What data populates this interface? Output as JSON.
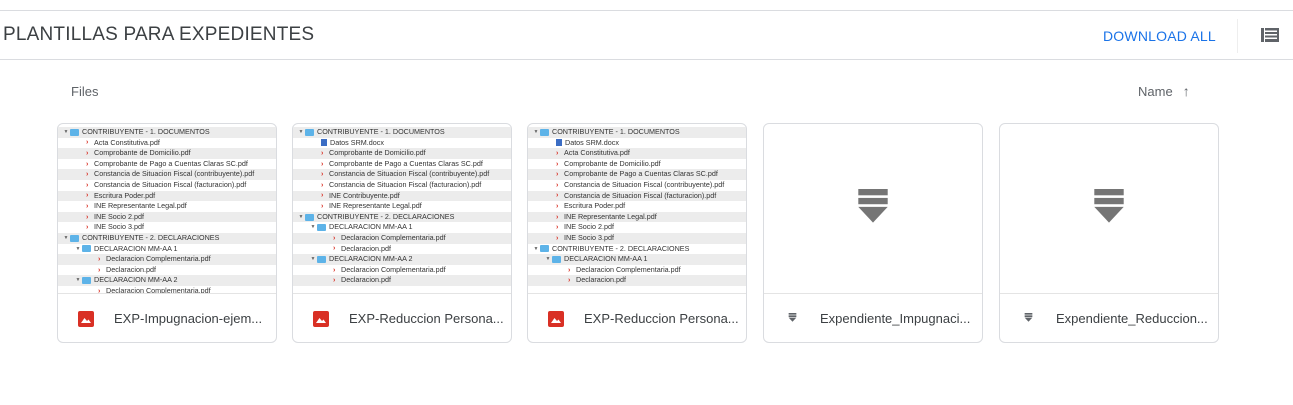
{
  "header": {
    "title": "PLANTILLAS PARA EXPEDIENTES",
    "download_all": "DOWNLOAD ALL",
    "view_icon": "list-view-icon"
  },
  "section": {
    "label": "Files",
    "sort_label": "Name",
    "sort_icon": "arrow-up-icon",
    "sort_symbol": "↑"
  },
  "colors": {
    "accent": "#1a73e8",
    "pdf_red": "#d93025",
    "folder_blue": "#5db3e8"
  },
  "files": [
    {
      "name": "EXP-Impugnacion-ejem...",
      "type": "image",
      "tree": [
        [
          0,
          "folder",
          "CONTRIBUYENTE - 1. DOCUMENTOS"
        ],
        [
          1,
          "pdf",
          "Acta Constitutiva.pdf"
        ],
        [
          1,
          "pdf",
          "Comprobante de Domicilio.pdf"
        ],
        [
          1,
          "pdf",
          "Comprobante de Pago a Cuentas Claras SC.pdf"
        ],
        [
          1,
          "pdf",
          "Constancia de Situacion Fiscal (contribuyente).pdf"
        ],
        [
          1,
          "pdf",
          "Constancia de Situacion Fiscal (facturacion).pdf"
        ],
        [
          1,
          "pdf",
          "Escritura Poder.pdf"
        ],
        [
          1,
          "pdf",
          "INE Representante Legal.pdf"
        ],
        [
          1,
          "pdf",
          "INE Socio 2.pdf"
        ],
        [
          1,
          "pdf",
          "INE Socio 3.pdf"
        ],
        [
          0,
          "folder",
          "CONTRIBUYENTE - 2. DECLARACIONES"
        ],
        [
          1,
          "folder",
          "DECLARACION MM-AA 1"
        ],
        [
          2,
          "pdf",
          "Declaracion Complementaria.pdf"
        ],
        [
          2,
          "pdf",
          "Declaracion.pdf"
        ],
        [
          1,
          "folder",
          "DECLARACION MM-AA 2"
        ],
        [
          2,
          "pdf",
          "Declaracion Complementaria.pdf"
        ]
      ]
    },
    {
      "name": "EXP-Reduccion Persona...",
      "type": "image",
      "tree": [
        [
          0,
          "folder",
          "CONTRIBUYENTE - 1. DOCUMENTOS"
        ],
        [
          1,
          "doc",
          "Datos SRM.docx"
        ],
        [
          1,
          "pdf",
          "Comprobante de Domicilio.pdf"
        ],
        [
          1,
          "pdf",
          "Comprobante de Pago a Cuentas Claras SC.pdf"
        ],
        [
          1,
          "pdf",
          "Constancia de Situacion Fiscal (contribuyente).pdf"
        ],
        [
          1,
          "pdf",
          "Constancia de Situacion Fiscal (facturacion).pdf"
        ],
        [
          1,
          "pdf",
          "INE Contribuyente.pdf"
        ],
        [
          1,
          "pdf",
          "INE Representante Legal.pdf"
        ],
        [
          0,
          "folder",
          "CONTRIBUYENTE - 2. DECLARACIONES"
        ],
        [
          1,
          "folder",
          "DECLARACION MM-AA 1"
        ],
        [
          2,
          "pdf",
          "Declaracion Complementaria.pdf"
        ],
        [
          2,
          "pdf",
          "Declaracion.pdf"
        ],
        [
          1,
          "folder",
          "DECLARACION MM-AA 2"
        ],
        [
          2,
          "pdf",
          "Declaracion Complementaria.pdf"
        ],
        [
          2,
          "pdf",
          "Declaracion.pdf"
        ]
      ]
    },
    {
      "name": "EXP-Reduccion Persona...",
      "type": "image",
      "tree": [
        [
          0,
          "folder",
          "CONTRIBUYENTE - 1. DOCUMENTOS"
        ],
        [
          1,
          "doc",
          "Datos SRM.docx"
        ],
        [
          1,
          "pdf",
          "Acta Constitutiva.pdf"
        ],
        [
          1,
          "pdf",
          "Comprobante de Domicilio.pdf"
        ],
        [
          1,
          "pdf",
          "Comprobante de Pago a Cuentas Claras SC.pdf"
        ],
        [
          1,
          "pdf",
          "Constancia de Situacion Fiscal (contribuyente).pdf"
        ],
        [
          1,
          "pdf",
          "Constancia de Situacion Fiscal (facturacion).pdf"
        ],
        [
          1,
          "pdf",
          "Escritura Poder.pdf"
        ],
        [
          1,
          "pdf",
          "INE Representante Legal.pdf"
        ],
        [
          1,
          "pdf",
          "INE Socio 2.pdf"
        ],
        [
          1,
          "pdf",
          "INE Socio 3.pdf"
        ],
        [
          0,
          "folder",
          "CONTRIBUYENTE - 2. DECLARACIONES"
        ],
        [
          1,
          "folder",
          "DECLARACION MM-AA 1"
        ],
        [
          2,
          "pdf",
          "Declaracion Complementaria.pdf"
        ],
        [
          2,
          "pdf",
          "Declaracion.pdf"
        ]
      ]
    },
    {
      "name": "Expendiente_Impugnaci...",
      "type": "generic",
      "icon": "download-file-icon"
    },
    {
      "name": "Expendiente_Reduccion...",
      "type": "generic",
      "icon": "download-file-icon"
    }
  ]
}
